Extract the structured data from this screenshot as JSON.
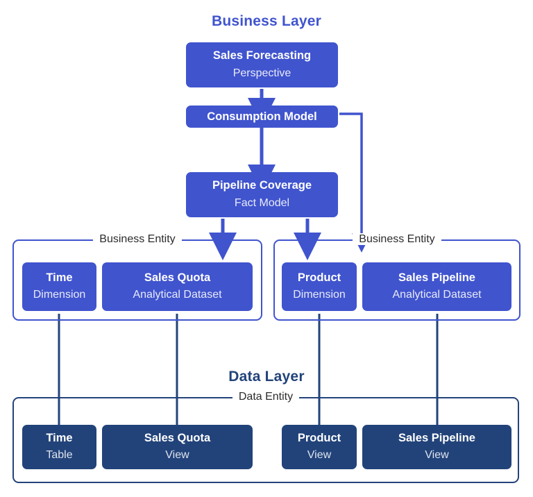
{
  "diagram": {
    "layers": [
      {
        "id": "business",
        "title": "Business Layer",
        "color": "#4054CE"
      },
      {
        "id": "data",
        "title": "Data Layer",
        "color": "#22437A"
      }
    ],
    "business_nodes": [
      {
        "id": "sales-forecasting",
        "title": "Sales Forecasting",
        "subtitle": "Perspective"
      },
      {
        "id": "consumption-model",
        "title": "Consumption Model",
        "subtitle": ""
      },
      {
        "id": "pipeline-coverage",
        "title": "Pipeline Coverage",
        "subtitle": "Fact Model"
      }
    ],
    "business_entities": [
      {
        "id": "business-entity-left",
        "label": "Business Entity",
        "nodes": [
          {
            "id": "time",
            "title": "Time",
            "subtitle": "Dimension"
          },
          {
            "id": "sales-quota",
            "title": "Sales Quota",
            "subtitle": "Analytical Dataset"
          }
        ]
      },
      {
        "id": "business-entity-right",
        "label": "Business Entity",
        "nodes": [
          {
            "id": "product",
            "title": "Product",
            "subtitle": "Dimension"
          },
          {
            "id": "sales-pipeline",
            "title": "Sales Pipeline",
            "subtitle": "Analytical Dataset"
          }
        ]
      }
    ],
    "data_entity": {
      "id": "data-entity",
      "label": "Data Entity",
      "nodes": [
        {
          "id": "time",
          "title": "Time",
          "subtitle": "Table"
        },
        {
          "id": "sales-quota",
          "title": "Sales Quota",
          "subtitle": "View"
        },
        {
          "id": "product",
          "title": "Product",
          "subtitle": "View"
        },
        {
          "id": "sales-pipeline",
          "title": "Sales Pipeline",
          "subtitle": "View"
        }
      ]
    }
  }
}
